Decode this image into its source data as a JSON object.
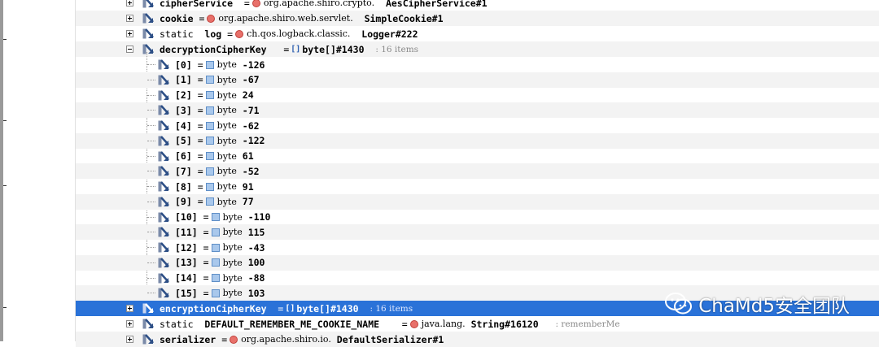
{
  "rows": {
    "cipherService": {
      "name": "cipherService",
      "eq": "=",
      "type_ns": "org.apache.shiro.crypto.",
      "type_class": "AesCipherService#1"
    },
    "cookie": {
      "name": "cookie",
      "eq": "=",
      "type_ns": "org.apache.shiro.web.servlet.",
      "type_class": "SimpleCookie#1"
    },
    "log": {
      "mod": "static",
      "name": "log",
      "eq": "=",
      "type_ns": "ch.qos.logback.classic.",
      "type_class": "Logger#222"
    },
    "decryption": {
      "name": "decryptionCipherKey",
      "eq": "=",
      "type": "byte[]#1430",
      "count": ": 16 items"
    },
    "encryption": {
      "name": "encryptionCipherKey",
      "eq": "=",
      "type": "byte[]#1430",
      "count": ": 16 items"
    },
    "remember": {
      "mod": "static",
      "name": "DEFAULT_REMEMBER_ME_COOKIE_NAME",
      "eq": "=",
      "type_ns": "java.lang.",
      "type_class": "String#16120",
      "value": ": rememberMe"
    },
    "serializer": {
      "name": "serializer",
      "eq": "=",
      "type_ns": "org.apache.shiro.io.",
      "type_class": "DefaultSerializer#1"
    }
  },
  "bytes": [
    {
      "idx": "[0]",
      "eq": "=",
      "type": "byte",
      "val": "-126"
    },
    {
      "idx": "[1]",
      "eq": "=",
      "type": "byte",
      "val": "-67"
    },
    {
      "idx": "[2]",
      "eq": "=",
      "type": "byte",
      "val": "24"
    },
    {
      "idx": "[3]",
      "eq": "=",
      "type": "byte",
      "val": "-71"
    },
    {
      "idx": "[4]",
      "eq": "=",
      "type": "byte",
      "val": "-62"
    },
    {
      "idx": "[5]",
      "eq": "=",
      "type": "byte",
      "val": "-122"
    },
    {
      "idx": "[6]",
      "eq": "=",
      "type": "byte",
      "val": "61"
    },
    {
      "idx": "[7]",
      "eq": "=",
      "type": "byte",
      "val": "-52"
    },
    {
      "idx": "[8]",
      "eq": "=",
      "type": "byte",
      "val": "91"
    },
    {
      "idx": "[9]",
      "eq": "=",
      "type": "byte",
      "val": "77"
    },
    {
      "idx": "[10]",
      "eq": "=",
      "type": "byte",
      "val": "-110"
    },
    {
      "idx": "[11]",
      "eq": "=",
      "type": "byte",
      "val": "115"
    },
    {
      "idx": "[12]",
      "eq": "=",
      "type": "byte",
      "val": "-43"
    },
    {
      "idx": "[13]",
      "eq": "=",
      "type": "byte",
      "val": "100"
    },
    {
      "idx": "[14]",
      "eq": "=",
      "type": "byte",
      "val": "-88"
    },
    {
      "idx": "[15]",
      "eq": "=",
      "type": "byte",
      "val": "103"
    }
  ],
  "watermark": {
    "text": "ChaMd5安全团队"
  },
  "colors": {
    "selection": "#2a72d8",
    "object_icon": "#e8706a",
    "primitive_icon": "#a9c8ec"
  },
  "icons": {
    "field": "field-icon",
    "object": "object-instance-icon",
    "primitive": "primitive-value-icon",
    "array": "array-icon"
  }
}
